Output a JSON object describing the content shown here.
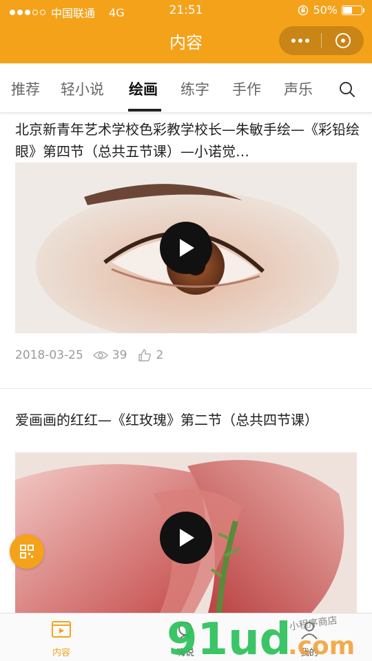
{
  "status": {
    "carrier": "中国联通",
    "network": "4G",
    "time": "21:51",
    "battery": "50%",
    "battery_level": 0.5
  },
  "header": {
    "title": "内容",
    "accent": "#F5A21B",
    "more_icon": "ellipsis-icon",
    "close_icon": "target-close-icon"
  },
  "tabs": [
    {
      "label": "推荐"
    },
    {
      "label": "轻小说"
    },
    {
      "label": "绘画",
      "active": true
    },
    {
      "label": "练字"
    },
    {
      "label": "手作"
    },
    {
      "label": "声乐"
    }
  ],
  "feed": [
    {
      "title": "北京新青年艺术学校色彩教学校长—朱敏手绘—《彩铅绘眼》第四节（总共五节课）—小诺觉…",
      "date": "2018-03-25",
      "views": "39",
      "likes": "2"
    },
    {
      "title": "爱画画的红红—《红玫瑰》第二节（总共四节课）"
    }
  ],
  "bottom_nav": [
    {
      "label": "内容",
      "icon": "video-icon",
      "active": true
    },
    {
      "label": "嗨说",
      "icon": "chat-icon"
    },
    {
      "label": "我的",
      "icon": "user-icon"
    }
  ],
  "watermark": {
    "brand": "91ud.com",
    "tagline": "小程序商店"
  }
}
